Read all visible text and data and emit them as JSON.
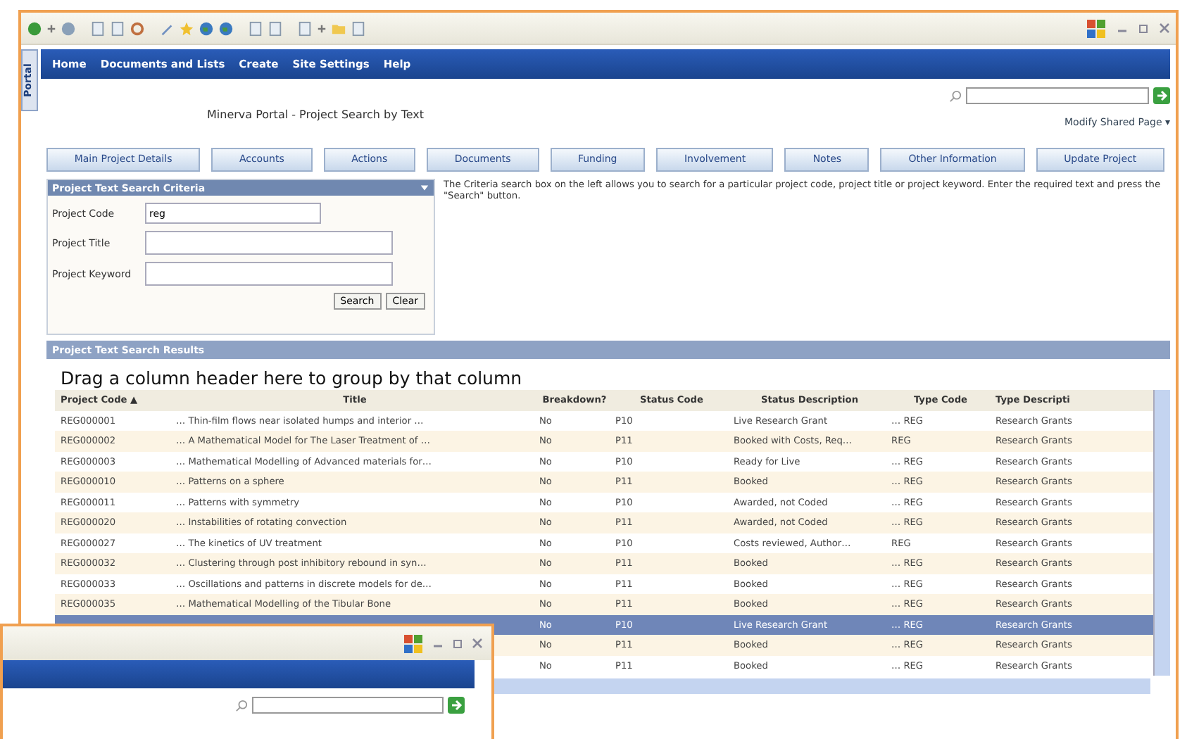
{
  "side_tab": "Portal",
  "nav": [
    "Home",
    "Documents and Lists",
    "Create",
    "Site Settings",
    "Help"
  ],
  "page_title": "Minerva Portal - Project Search by Text",
  "modify_link": "Modify Shared Page ▾",
  "tabs": [
    {
      "label": "Main Project Details",
      "selected": false
    },
    {
      "label": "Accounts",
      "selected": false
    },
    {
      "label": "Actions",
      "selected": false
    },
    {
      "label": "Documents",
      "selected": false
    },
    {
      "label": "Funding",
      "selected": false
    },
    {
      "label": "Involvement",
      "selected": false
    },
    {
      "label": "Notes",
      "selected": false
    },
    {
      "label": "Other Information",
      "selected": false
    },
    {
      "label": "Update Project",
      "selected": false
    }
  ],
  "criteria": {
    "title": "Project Text Search Criteria",
    "fields": [
      {
        "label": "Project Code",
        "value": "reg"
      },
      {
        "label": "Project Title"
      },
      {
        "label": "Project Keyword"
      }
    ],
    "buttons": [
      "Search",
      "Clear"
    ]
  },
  "help_text": "The Criteria search box on the left allows you to search for a particular project code, project title or project keyword. Enter the required text and press the \"Search\" button.",
  "results": {
    "title": "Project Text Search Results",
    "group_hint": "Drag a column header here to group by that column",
    "columns": [
      "Project Code ▲",
      "Title",
      "Breakdown?",
      "Status Code",
      "Status Description",
      "Type Code",
      "Type Descripti"
    ],
    "rows": [
      {
        "selected": false,
        "cells": [
          "REG000001",
          "… Thin-film flows near isolated humps and interior …",
          "No",
          "P10",
          "Live Research Grant",
          "… REG",
          "Research Grants"
        ]
      },
      {
        "selected": false,
        "cells": [
          "REG000002",
          "… A Mathematical Model for The Laser Treatment of …",
          "No",
          "P11",
          "Booked with Costs, Req…",
          "REG",
          "Research Grants"
        ]
      },
      {
        "selected": false,
        "cells": [
          "REG000003",
          "… Mathematical Modelling of Advanced materials for…",
          "No",
          "P10",
          "Ready for Live",
          "… REG",
          "Research Grants"
        ]
      },
      {
        "selected": false,
        "cells": [
          "REG000010",
          "… Patterns on a sphere",
          "No",
          "P11",
          "Booked",
          "… REG",
          "Research Grants"
        ]
      },
      {
        "selected": false,
        "cells": [
          "REG000011",
          "… Patterns with symmetry",
          "No",
          "P10",
          "Awarded, not Coded",
          "… REG",
          "Research Grants"
        ]
      },
      {
        "selected": false,
        "cells": [
          "REG000020",
          "… Instabilities of rotating convection",
          "No",
          "P11",
          "Awarded, not Coded",
          "… REG",
          "Research Grants"
        ]
      },
      {
        "selected": false,
        "cells": [
          "REG000027",
          "… The kinetics of UV treatment",
          "No",
          "P10",
          "Costs reviewed, Author…",
          "REG",
          "Research Grants"
        ]
      },
      {
        "selected": false,
        "cells": [
          "REG000032",
          "… Clustering through post inhibitory rebound in syn…",
          "No",
          "P11",
          "Booked",
          "… REG",
          "Research Grants"
        ]
      },
      {
        "selected": false,
        "cells": [
          "REG000033",
          "… Oscillations and patterns in discrete models for de…",
          "No",
          "P11",
          "Booked",
          "… REG",
          "Research Grants"
        ]
      },
      {
        "selected": false,
        "cells": [
          "REG000035",
          "… Mathematical Modelling of the Tibular Bone",
          "No",
          "P11",
          "Booked",
          "… REG",
          "Research Grants"
        ]
      },
      {
        "selected": true,
        "cells": [
          null,
          null,
          "No",
          "P10",
          "Live Research Grant",
          "… REG",
          "Research Grants"
        ]
      },
      {
        "selected": false,
        "cells": [
          null,
          null,
          "No",
          "P11",
          "Booked",
          "… REG",
          "Research Grants"
        ]
      },
      {
        "selected": false,
        "cells": [
          null,
          null,
          "No",
          "P11",
          "Booked",
          "… REG",
          "Research Grants"
        ]
      }
    ]
  }
}
